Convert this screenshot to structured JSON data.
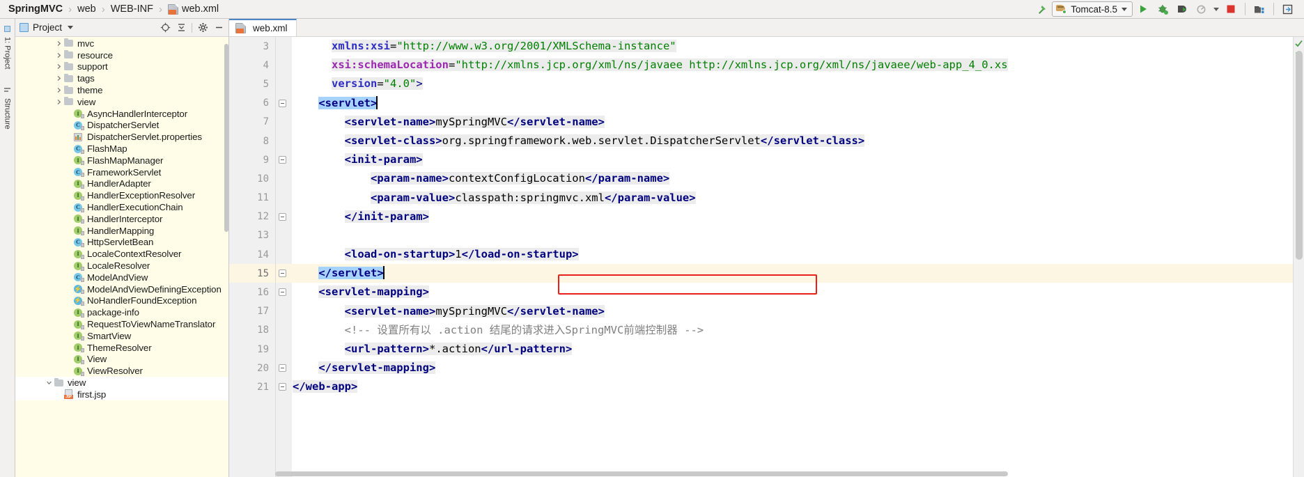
{
  "window": {
    "breadcrumb": [
      {
        "label": "SpringMVC",
        "bold": true,
        "icon": ""
      },
      {
        "label": "web",
        "bold": false,
        "icon": ""
      },
      {
        "label": "WEB-INF",
        "bold": false,
        "icon": ""
      },
      {
        "label": "web.xml",
        "bold": false,
        "icon": "xml-file-icon"
      }
    ],
    "breadcrumb_separator": "›"
  },
  "toolbar": {
    "build_icon": "hammer-icon",
    "run_config": {
      "name": "Tomcat-8.5",
      "icon": "tomcat-icon",
      "dropdown": "chevron-down-icon"
    },
    "run_button": "run-icon",
    "debug_button": "debug-icon",
    "run_coverage_button": "run-with-coverage-icon",
    "profile_button": "profile-icon",
    "stop_button": "stop-icon",
    "deploy_button": "deploy-icon",
    "extra_button": "update-app-icon"
  },
  "rail": {
    "items": [
      {
        "label": "1: Project",
        "icon": "project-tool-icon"
      },
      {
        "label": "Structure",
        "icon": "structure-tool-icon"
      }
    ]
  },
  "project_panel": {
    "title": "Project",
    "title_icon": "project-view-icon",
    "dropdown_icon": "chevron-down-icon",
    "tools": [
      "locate-icon",
      "collapse-all-icon",
      "settings-gear-icon",
      "hide-icon"
    ],
    "tree": [
      {
        "label": "mvc",
        "icon": "folder-icon",
        "indent": 4,
        "arrow": "right",
        "bg": "yellow"
      },
      {
        "label": "resource",
        "icon": "folder-icon",
        "indent": 4,
        "arrow": "right",
        "bg": "yellow"
      },
      {
        "label": "support",
        "icon": "folder-icon",
        "indent": 4,
        "arrow": "right",
        "bg": "yellow"
      },
      {
        "label": "tags",
        "icon": "folder-icon",
        "indent": 4,
        "arrow": "right",
        "bg": "yellow"
      },
      {
        "label": "theme",
        "icon": "folder-icon",
        "indent": 4,
        "arrow": "right",
        "bg": "yellow"
      },
      {
        "label": "view",
        "icon": "folder-icon",
        "indent": 4,
        "arrow": "right",
        "bg": "yellow"
      },
      {
        "label": "AsyncHandlerInterceptor",
        "icon": "interface-icon",
        "indent": 5,
        "arrow": "none",
        "bg": "yellow"
      },
      {
        "label": "DispatcherServlet",
        "icon": "class-icon",
        "indent": 5,
        "arrow": "none",
        "bg": "yellow"
      },
      {
        "label": "DispatcherServlet.properties",
        "icon": "properties-icon",
        "indent": 5,
        "arrow": "none",
        "bg": "yellow"
      },
      {
        "label": "FlashMap",
        "icon": "class-icon",
        "indent": 5,
        "arrow": "none",
        "bg": "yellow"
      },
      {
        "label": "FlashMapManager",
        "icon": "interface-icon",
        "indent": 5,
        "arrow": "none",
        "bg": "yellow"
      },
      {
        "label": "FrameworkServlet",
        "icon": "class-icon",
        "indent": 5,
        "arrow": "none",
        "bg": "yellow"
      },
      {
        "label": "HandlerAdapter",
        "icon": "interface-icon",
        "indent": 5,
        "arrow": "none",
        "bg": "yellow"
      },
      {
        "label": "HandlerExceptionResolver",
        "icon": "interface-icon",
        "indent": 5,
        "arrow": "none",
        "bg": "yellow"
      },
      {
        "label": "HandlerExecutionChain",
        "icon": "class-icon",
        "indent": 5,
        "arrow": "none",
        "bg": "yellow"
      },
      {
        "label": "HandlerInterceptor",
        "icon": "interface-icon",
        "indent": 5,
        "arrow": "none",
        "bg": "yellow"
      },
      {
        "label": "HandlerMapping",
        "icon": "interface-icon",
        "indent": 5,
        "arrow": "none",
        "bg": "yellow"
      },
      {
        "label": "HttpServletBean",
        "icon": "class-icon",
        "indent": 5,
        "arrow": "none",
        "bg": "yellow"
      },
      {
        "label": "LocaleContextResolver",
        "icon": "interface-icon",
        "indent": 5,
        "arrow": "none",
        "bg": "yellow"
      },
      {
        "label": "LocaleResolver",
        "icon": "interface-icon",
        "indent": 5,
        "arrow": "none",
        "bg": "yellow"
      },
      {
        "label": "ModelAndView",
        "icon": "class-icon",
        "indent": 5,
        "arrow": "none",
        "bg": "yellow"
      },
      {
        "label": "ModelAndViewDefiningException",
        "icon": "exception-icon",
        "indent": 5,
        "arrow": "none",
        "bg": "yellow"
      },
      {
        "label": "NoHandlerFoundException",
        "icon": "exception-icon",
        "indent": 5,
        "arrow": "none",
        "bg": "yellow"
      },
      {
        "label": "package-info",
        "icon": "interface-icon",
        "indent": 5,
        "arrow": "none",
        "bg": "yellow"
      },
      {
        "label": "RequestToViewNameTranslator",
        "icon": "interface-icon",
        "indent": 5,
        "arrow": "none",
        "bg": "yellow"
      },
      {
        "label": "SmartView",
        "icon": "interface-icon",
        "indent": 5,
        "arrow": "none",
        "bg": "yellow"
      },
      {
        "label": "ThemeResolver",
        "icon": "interface-icon",
        "indent": 5,
        "arrow": "none",
        "bg": "yellow"
      },
      {
        "label": "View",
        "icon": "interface-icon",
        "indent": 5,
        "arrow": "none",
        "bg": "yellow"
      },
      {
        "label": "ViewResolver",
        "icon": "interface-icon",
        "indent": 5,
        "arrow": "none",
        "bg": "yellow"
      },
      {
        "label": "view",
        "icon": "folder-icon",
        "indent": 3,
        "arrow": "down",
        "bg": "white"
      },
      {
        "label": "first.jsp",
        "icon": "jsp-file-icon",
        "indent": 4,
        "arrow": "none",
        "bg": "white"
      }
    ]
  },
  "editor": {
    "tab": {
      "label": "web.xml",
      "icon": "xml-file-icon",
      "active": true
    },
    "first_line_number": 3,
    "caret_line": 15,
    "highlight_box": {
      "line": 14,
      "color": "#e8201a",
      "text": "<load-on-startup>1</load-on-startup>"
    },
    "lines": [
      {
        "n": 3,
        "indent": 6,
        "tokens": [
          {
            "t": "xmlns:xsi",
            "c": "attr2"
          },
          {
            "t": "=",
            "c": "txt"
          },
          {
            "t": "\"http://www.w3.org/2001/XMLSchema-instance\"",
            "c": "val"
          }
        ],
        "hl": true
      },
      {
        "n": 4,
        "indent": 6,
        "tokens": [
          {
            "t": "xsi:schemaLocation",
            "c": "attr"
          },
          {
            "t": "=",
            "c": "txt"
          },
          {
            "t": "\"http://xmlns.jcp.org/xml/ns/javaee http://xmlns.jcp.org/xml/ns/javaee/web-app_4_0.xs",
            "c": "val"
          }
        ],
        "hl": true
      },
      {
        "n": 5,
        "indent": 6,
        "tokens": [
          {
            "t": "version",
            "c": "attr2"
          },
          {
            "t": "=",
            "c": "txt"
          },
          {
            "t": "\"4.0\"",
            "c": "val"
          },
          {
            "t": ">",
            "c": "brk"
          }
        ],
        "hl": true
      },
      {
        "n": 6,
        "indent": 4,
        "tokens": [
          {
            "t": "<servlet>",
            "c": "tag",
            "sel": true
          }
        ],
        "fold": true
      },
      {
        "n": 7,
        "indent": 8,
        "tokens": [
          {
            "t": "<servlet-name>",
            "c": "tag"
          },
          {
            "t": "mySpringMVC",
            "c": "txt"
          },
          {
            "t": "</servlet-name>",
            "c": "tag"
          }
        ]
      },
      {
        "n": 8,
        "indent": 8,
        "tokens": [
          {
            "t": "<servlet-class>",
            "c": "tag"
          },
          {
            "t": "org.springframework.web.servlet.DispatcherServlet",
            "c": "txt"
          },
          {
            "t": "</servlet-class>",
            "c": "tag"
          }
        ]
      },
      {
        "n": 9,
        "indent": 8,
        "tokens": [
          {
            "t": "<init-param>",
            "c": "tag"
          }
        ],
        "fold": true
      },
      {
        "n": 10,
        "indent": 12,
        "tokens": [
          {
            "t": "<param-name>",
            "c": "tag"
          },
          {
            "t": "contextConfigLocation",
            "c": "txt"
          },
          {
            "t": "</param-name>",
            "c": "tag"
          }
        ]
      },
      {
        "n": 11,
        "indent": 12,
        "tokens": [
          {
            "t": "<param-value>",
            "c": "tag"
          },
          {
            "t": "classpath:springmvc.xml",
            "c": "txt"
          },
          {
            "t": "</param-value>",
            "c": "tag"
          }
        ]
      },
      {
        "n": 12,
        "indent": 8,
        "tokens": [
          {
            "t": "</init-param>",
            "c": "tag"
          }
        ],
        "fold": true
      },
      {
        "n": 13,
        "indent": 0,
        "tokens": []
      },
      {
        "n": 14,
        "indent": 8,
        "tokens": [
          {
            "t": "<load-on-startup>",
            "c": "tag"
          },
          {
            "t": "1",
            "c": "txt"
          },
          {
            "t": "</load-on-startup>",
            "c": "tag"
          }
        ]
      },
      {
        "n": 15,
        "indent": 4,
        "tokens": [
          {
            "t": "</servlet>",
            "c": "tag",
            "sel": true
          }
        ],
        "cur": true,
        "fold": true,
        "bulb": true
      },
      {
        "n": 16,
        "indent": 4,
        "tokens": [
          {
            "t": "<servlet-mapping>",
            "c": "tag"
          }
        ],
        "fold": true
      },
      {
        "n": 17,
        "indent": 8,
        "tokens": [
          {
            "t": "<servlet-name>",
            "c": "tag"
          },
          {
            "t": "mySpringMVC",
            "c": "txt"
          },
          {
            "t": "</servlet-name>",
            "c": "tag"
          }
        ]
      },
      {
        "n": 18,
        "indent": 8,
        "tokens": [
          {
            "t": "<!-- 设置所有以 .action 结尾的请求进入SpringMVC前端控制器 -->",
            "c": "cmt"
          }
        ]
      },
      {
        "n": 19,
        "indent": 8,
        "tokens": [
          {
            "t": "<url-pattern>",
            "c": "tag"
          },
          {
            "t": "*.action",
            "c": "txt"
          },
          {
            "t": "</url-pattern>",
            "c": "tag"
          }
        ]
      },
      {
        "n": 20,
        "indent": 4,
        "tokens": [
          {
            "t": "</servlet-mapping>",
            "c": "tag"
          }
        ],
        "fold": true
      },
      {
        "n": 21,
        "indent": 0,
        "tokens": [
          {
            "t": "</web-app>",
            "c": "tag"
          }
        ],
        "fold": true
      }
    ]
  },
  "colors": {
    "accent_blue": "#4a86c8",
    "tag_blue": "#000080",
    "value_green": "#008000",
    "attr_purple": "#9c27b0",
    "comment_gray": "#808080",
    "highlight_red": "#e8201a",
    "caret_row_yellow": "#fcf6e2",
    "tree_yellow": "#fffde8",
    "selection_blue": "#a6d2ff"
  }
}
